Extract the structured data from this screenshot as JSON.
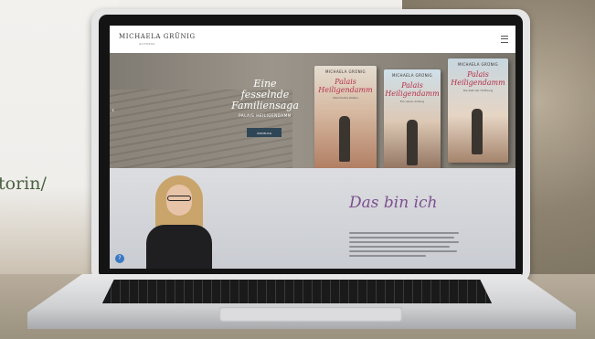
{
  "background": {
    "partial_text": "torin/"
  },
  "site": {
    "logo": "MICHAELA GRÜNIG",
    "logo_sub": "AUTORIN",
    "hero": {
      "title_line1": "Eine fesselnde",
      "title_line2": "Familiensaga",
      "subtitle": "PALAIS HEILIGENDAMM",
      "button_label": "ZUM BUCH"
    },
    "books": [
      {
        "author": "MICHAELA GRÜNIG",
        "title": "Palais Heiligendamm",
        "subtitle": "Stürmische Zeiten"
      },
      {
        "author": "MICHAELA GRÜNIG",
        "title": "Palais Heiligendamm",
        "subtitle": "Ein neuer Anfang"
      },
      {
        "author": "MICHAELA GRÜNIG",
        "title": "Palais Heiligendamm",
        "subtitle": "Die Zeit der Hoffnung"
      }
    ],
    "about": {
      "title": "Das bin ich"
    }
  },
  "colors": {
    "hero_button": "#2f4656",
    "about_title": "#7d4f8f",
    "book_title": "#b6314a",
    "help_icon": "#3a78c2"
  },
  "icons": [
    "menu-icon",
    "chevron-left-icon",
    "help-icon"
  ]
}
